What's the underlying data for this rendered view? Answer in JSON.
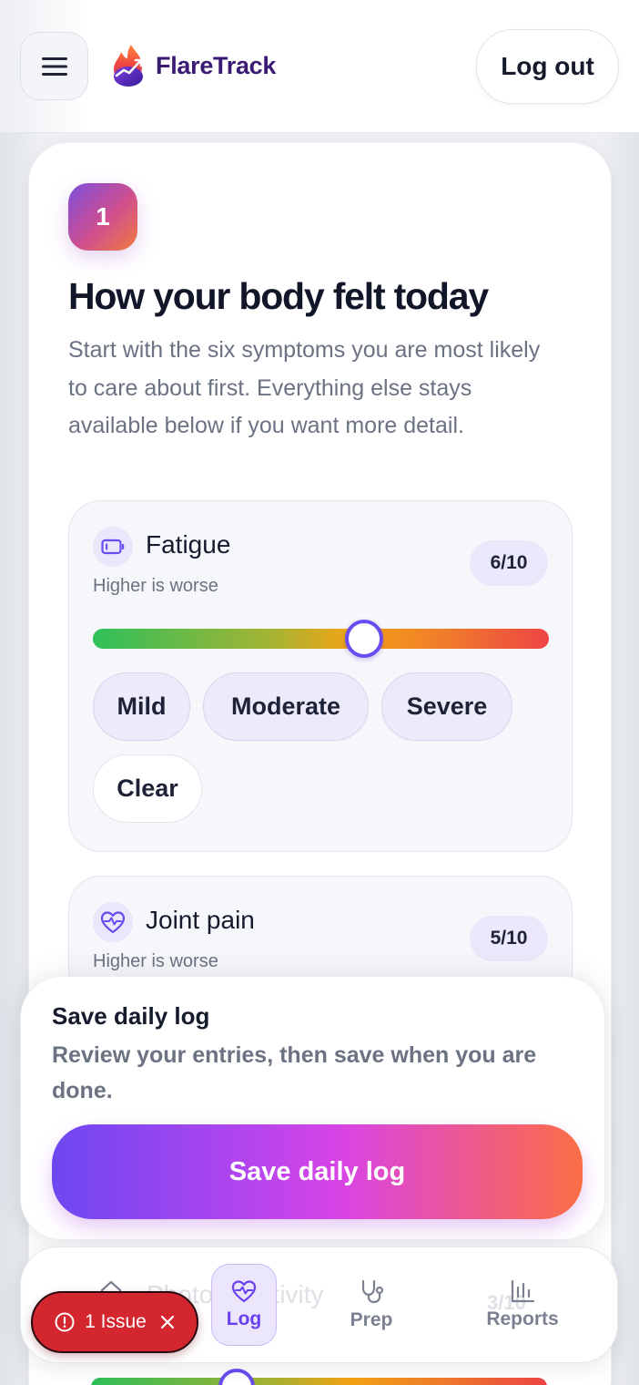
{
  "header": {
    "brand_name": "FlareTrack",
    "logout_label": "Log out",
    "menu_icon": "hamburger-menu-icon"
  },
  "section": {
    "step_number": "1",
    "title": "How your body felt today",
    "description": "Start with the six symptoms you are most likely to care about first. Everything else stays available below if you want more detail."
  },
  "symptoms": [
    {
      "name": "Fatigue",
      "hint": "Higher is worse",
      "score_label": "6/10",
      "value": 6,
      "max": 10,
      "icon": "battery-icon",
      "chips": [
        "Mild",
        "Moderate",
        "Severe",
        "Clear"
      ]
    },
    {
      "name": "Joint pain",
      "hint": "Higher is worse",
      "score_label": "5/10",
      "value": 5,
      "max": 10,
      "icon": "heart-pulse-icon"
    }
  ],
  "save_panel": {
    "title": "Save daily log",
    "description": "Review your entries, then save when you are done.",
    "button_label": "Save daily log"
  },
  "bottom_nav": {
    "items": [
      {
        "label": "",
        "icon": "home-icon"
      },
      {
        "label": "Log",
        "icon": "heart-pulse-icon",
        "active": true
      },
      {
        "label": "Prep",
        "icon": "stethoscope-icon"
      },
      {
        "label": "Reports",
        "icon": "bar-chart-icon"
      }
    ],
    "ghost_text": "Photosensitivity",
    "ghost_score": "3/10"
  },
  "issue_badge": {
    "label": "1 Issue"
  },
  "colors": {
    "accent": "#6a4df0",
    "brand": "#3b1a74",
    "danger": "#d4262f"
  }
}
